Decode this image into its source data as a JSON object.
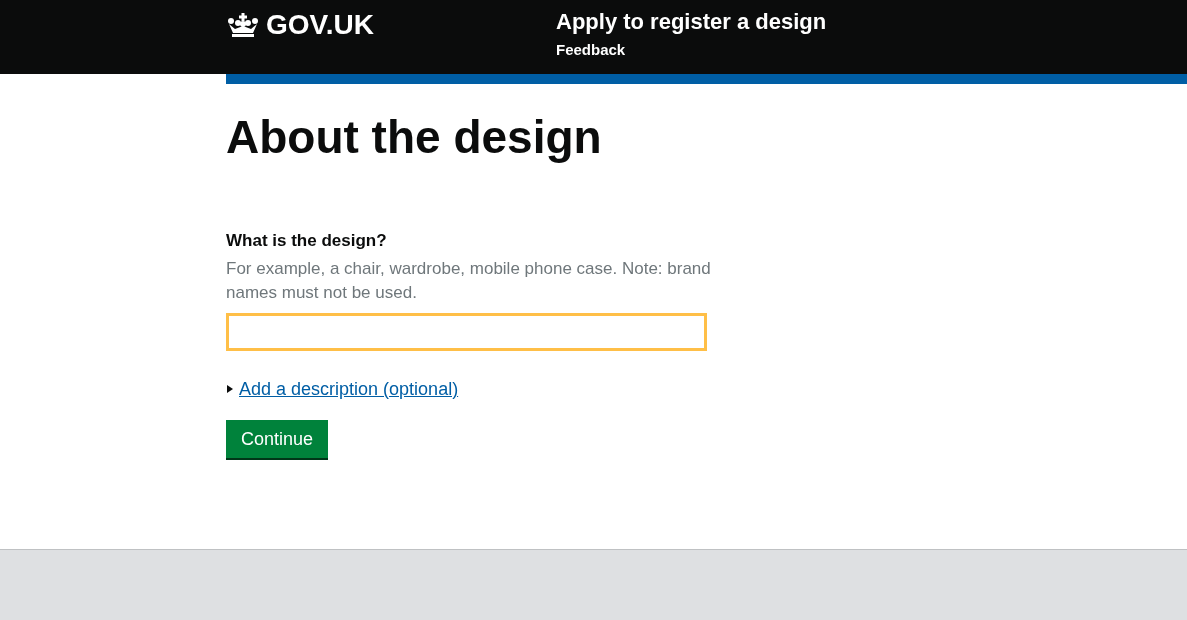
{
  "header": {
    "logo": "GOV.UK",
    "service_name": "Apply to register a design",
    "feedback_link": "Feedback"
  },
  "page": {
    "heading": "About the design",
    "question": {
      "label": "What is the design?",
      "hint": "For example, a chair, wardrobe, mobile phone case. Note: brand names must not be used.",
      "focused": true
    },
    "details": {
      "summary": "Add a description (optional)",
      "expanded": false
    },
    "button": "Continue"
  }
}
